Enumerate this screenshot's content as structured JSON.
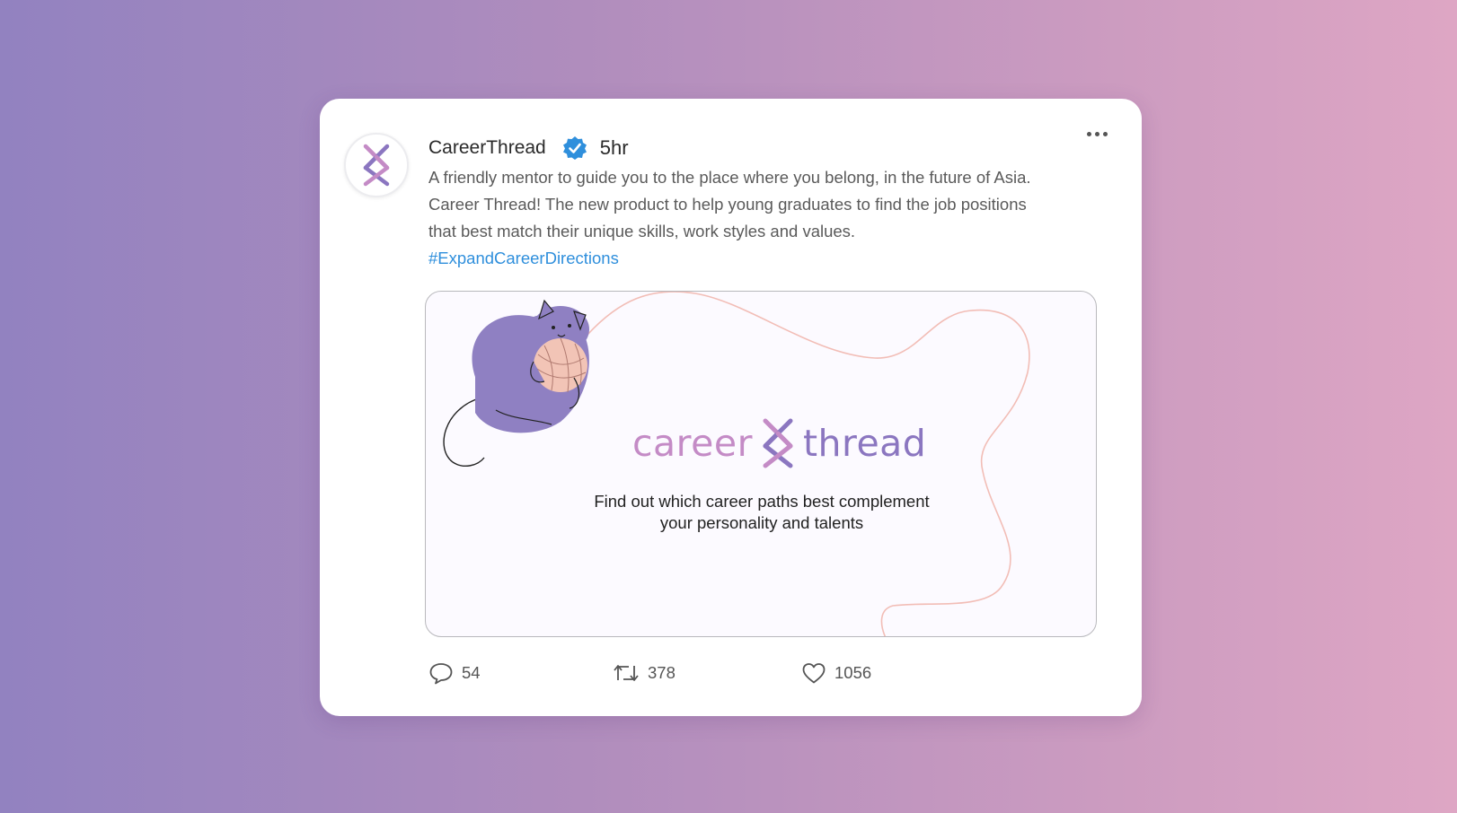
{
  "post": {
    "username": "CareerThread",
    "time": "5hr",
    "text_lines": [
      "A friendly mentor to guide you to the place where you belong, in the future of Asia.",
      "Career Thread! The new product to help young graduates to find the job positions",
      "that best match their unique skills, work styles and values."
    ],
    "hashtag": "#ExpandCareerDirections"
  },
  "media": {
    "brand_word_1": "career",
    "brand_word_2": "thread",
    "tagline_line_1": "Find out which career paths best complement",
    "tagline_line_2": "your personality and talents"
  },
  "actions": {
    "replies": "54",
    "retweets": "378",
    "likes": "1056"
  },
  "colors": {
    "verified_badge": "#2f8fdc",
    "hashtag": "#2f8fdc",
    "brand_pink": "#c48bc6",
    "brand_purple": "#8b76c0",
    "cat": "#8f80c2",
    "yarn": "#f2c4b6"
  },
  "icons": [
    "logo-icon",
    "verified-badge-icon",
    "more-icon",
    "reply-icon",
    "retweet-icon",
    "like-icon",
    "cat-illustration"
  ]
}
